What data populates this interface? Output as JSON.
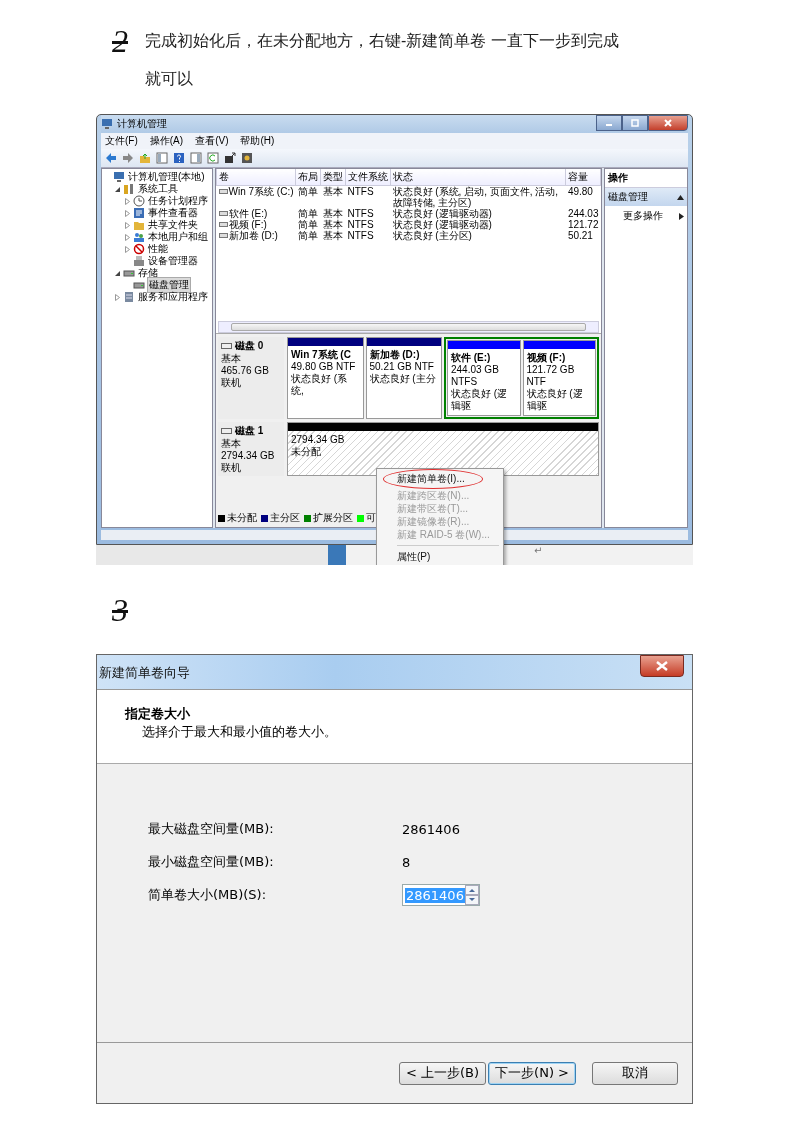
{
  "steps": [
    {
      "number": "2",
      "text": "完成初始化后，在未分配地方，右键-新建简单卷 一直下一步到完成就可以"
    },
    {
      "number": "3"
    }
  ],
  "disk_management_window": {
    "title": "计算机管理",
    "menu": [
      "文件(F)",
      "操作(A)",
      "查看(V)",
      "帮助(H)"
    ],
    "tree": [
      {
        "label": "计算机管理(本地)",
        "selected": false,
        "children": [
          {
            "label": "系统工具",
            "expanded": true,
            "selected": false,
            "children": [
              {
                "label": "任务计划程序",
                "expanded": false,
                "selected": false
              },
              {
                "label": "事件查看器",
                "expanded": false,
                "selected": false
              },
              {
                "label": "共享文件夹",
                "expanded": false,
                "selected": false
              },
              {
                "label": "本地用户和组",
                "expanded": false,
                "selected": false
              },
              {
                "label": "性能",
                "expanded": false,
                "selected": false
              },
              {
                "label": "设备管理器",
                "selected": false
              }
            ]
          },
          {
            "label": "存储",
            "expanded": true,
            "selected": false,
            "children": [
              {
                "label": "磁盘管理",
                "selected": true
              }
            ]
          },
          {
            "label": "服务和应用程序",
            "expanded": false,
            "selected": false
          }
        ]
      }
    ],
    "volumes": {
      "columns": [
        "卷",
        "布局",
        "类型",
        "文件系统",
        "状态",
        "容量"
      ],
      "rows": [
        {
          "cells": [
            "Win 7系统 (C:)",
            "简单",
            "基本",
            "NTFS",
            "状态良好 (系统, 启动, 页面文件, 活动, 故障转储, 主分区)",
            "49.80"
          ]
        },
        {
          "cells": [
            "软件 (E:)",
            "简单",
            "基本",
            "NTFS",
            "状态良好 (逻辑驱动器)",
            "244.03"
          ]
        },
        {
          "cells": [
            "视频 (F:)",
            "简单",
            "基本",
            "NTFS",
            "状态良好 (逻辑驱动器)",
            "121.72"
          ]
        },
        {
          "cells": [
            "新加卷 (D:)",
            "简单",
            "基本",
            "NTFS",
            "状态良好 (主分区)",
            "50.21"
          ]
        }
      ]
    },
    "disks": [
      {
        "name": "磁盘 0",
        "type": "基本",
        "size": "465.76 GB",
        "status": "联机",
        "partitions": [
          {
            "kind": "primary",
            "color": "#00007f",
            "name": "Win 7系统 (C",
            "size": "49.80 GB NTF",
            "status": "状态良好 (系统,"
          },
          {
            "kind": "primary",
            "color": "#00007f",
            "name": "新加卷 (D:)",
            "size": "50.21 GB NTF",
            "status": "状态良好 (主分"
          },
          {
            "kind": "extended",
            "color": "#008000",
            "children": [
              {
                "kind": "logical",
                "color": "#0000ff",
                "name": "软件 (E:)",
                "size": "244.03 GB NTFS",
                "status": "状态良好 (逻辑驱"
              },
              {
                "kind": "logical",
                "color": "#0000ff",
                "name": "视频 (F:)",
                "size": "121.72 GB NTF",
                "status": "状态良好 (逻辑驱"
              }
            ]
          }
        ]
      },
      {
        "name": "磁盘 1",
        "type": "基本",
        "size": "2794.34 GB",
        "status": "联机",
        "partitions": [
          {
            "kind": "unallocated",
            "color": "#000000",
            "size": "2794.34 GB",
            "status": "未分配"
          }
        ]
      }
    ],
    "legend": [
      {
        "label": "未分配",
        "color": "#000000"
      },
      {
        "label": "主分区",
        "color": "#00007f"
      },
      {
        "label": "扩展分区",
        "color": "#008000"
      },
      {
        "label": "可",
        "color": "#00ff00"
      }
    ],
    "actions": {
      "header": "操作",
      "items": [
        {
          "kind": "section",
          "label": "磁盘管理",
          "expanded": true
        },
        {
          "kind": "item",
          "label": "更多操作"
        }
      ]
    },
    "context_menu": [
      {
        "label": "新建简单卷(I)...",
        "disabled": false,
        "highlighted": true
      },
      {
        "label": "新建跨区卷(N)...",
        "disabled": true,
        "highlighted": false
      },
      {
        "label": "新建带区卷(T)...",
        "disabled": true,
        "highlighted": false
      },
      {
        "label": "新建镜像卷(R)...",
        "disabled": true,
        "highlighted": false
      },
      {
        "label": "新建 RAID-5 卷(W)...",
        "disabled": true,
        "highlighted": false
      },
      {
        "kind": "separator"
      },
      {
        "label": "属性(P)",
        "disabled": false,
        "highlighted": false
      }
    ],
    "paragraph_mark": "↵"
  },
  "wizard_dialog": {
    "title": "新建简单卷向导",
    "heading": "指定卷大小",
    "subheading": "选择介于最大和最小值的卷大小。",
    "fields": [
      {
        "kind": "text",
        "label": "最大磁盘空间量(MB):",
        "value": "2861406"
      },
      {
        "kind": "text",
        "label": "最小磁盘空间量(MB):",
        "value": "8"
      },
      {
        "kind": "spin",
        "label": "简单卷大小(MB)(S):",
        "value": "2861406",
        "selected": true
      }
    ],
    "buttons": [
      {
        "label": "< 上一步(B)",
        "focused": false
      },
      {
        "label": "下一步(N) >",
        "focused": true
      },
      {
        "label": "取消",
        "focused": false
      }
    ]
  }
}
